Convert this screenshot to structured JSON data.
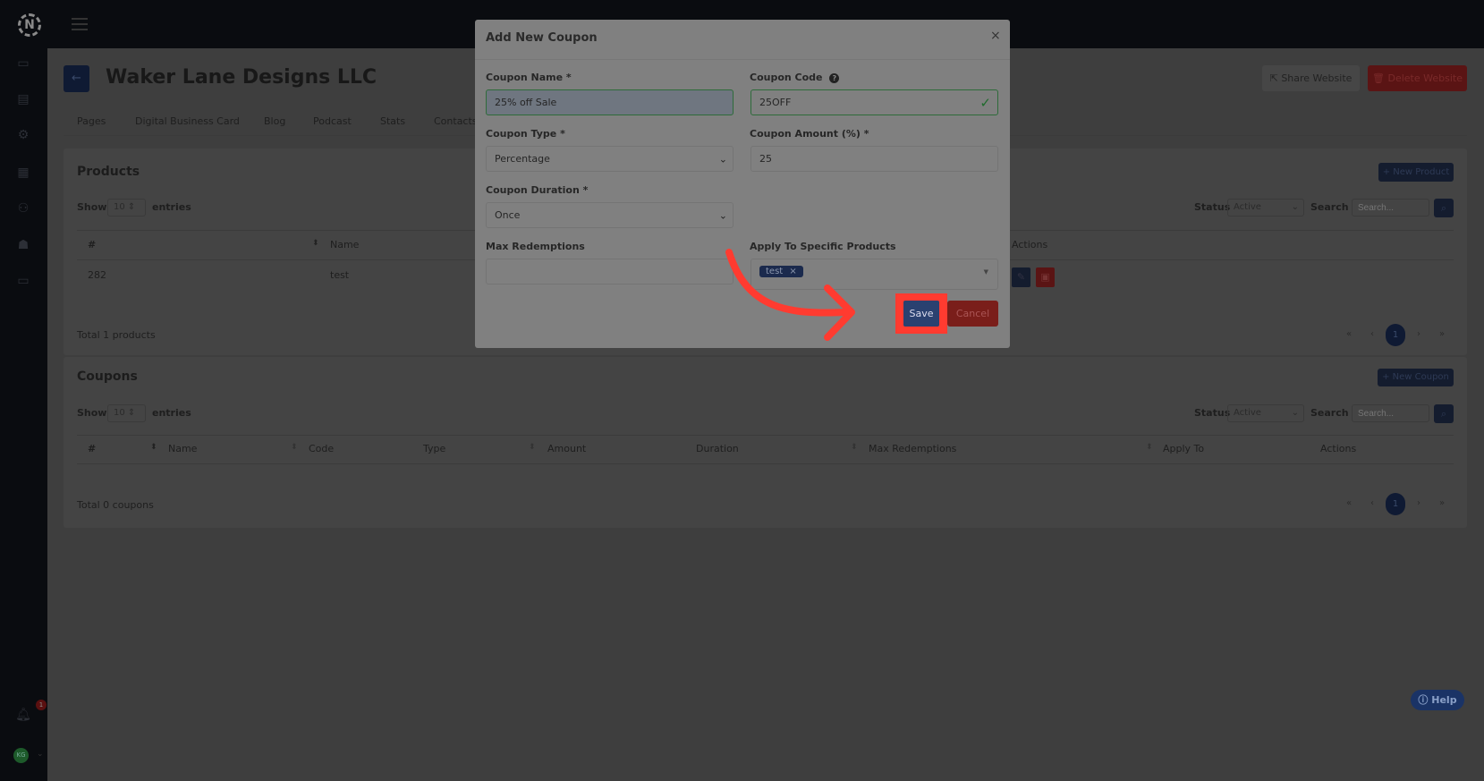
{
  "topbar": {
    "logo": "N",
    "menu_icon": "hamburger-icon"
  },
  "sidebar": {
    "icons": [
      "window-icon",
      "card-icon",
      "gear-icon",
      "widgets-icon",
      "add-user-icon",
      "team-icon",
      "video-icon"
    ],
    "notification_count": "1",
    "avatar_initials": "KG"
  },
  "header": {
    "title": "Waker Lane Designs LLC",
    "share_label": "Share Website",
    "delete_label": "Delete Website"
  },
  "tabs": [
    "Pages",
    "Digital Business Card",
    "Blog",
    "Podcast",
    "Stats",
    "Contacts"
  ],
  "products": {
    "title": "Products",
    "new_label": "New Product",
    "show": "Show",
    "entries_value": "10",
    "entries": "entries",
    "status_label": "Status",
    "status_value": "Active",
    "search_label": "Search",
    "search_placeholder": "Search...",
    "columns": [
      "#",
      "Name",
      "Actions"
    ],
    "rows": [
      {
        "id": "282",
        "name": "test"
      }
    ],
    "total": "Total 1 products",
    "page": "1"
  },
  "coupons": {
    "title": "Coupons",
    "new_label": "New Coupon",
    "show": "Show",
    "entries_value": "10",
    "entries": "entries",
    "status_label": "Status",
    "status_value": "Active",
    "search_label": "Search",
    "search_placeholder": "Search...",
    "columns": [
      "#",
      "Name",
      "Code",
      "Type",
      "Amount",
      "Duration",
      "Max Redemptions",
      "Apply To",
      "Actions"
    ],
    "total": "Total 0 coupons",
    "page": "1"
  },
  "modal": {
    "title": "Add New Coupon",
    "coupon_name_label": "Coupon Name *",
    "coupon_name_value": "25% off Sale",
    "coupon_code_label": "Coupon Code",
    "coupon_code_value": "25OFF",
    "coupon_type_label": "Coupon Type *",
    "coupon_type_value": "Percentage",
    "coupon_amount_label": "Coupon Amount (%) *",
    "coupon_amount_value": "25",
    "coupon_duration_label": "Coupon Duration *",
    "coupon_duration_value": "Once",
    "max_redemptions_label": "Max Redemptions",
    "max_redemptions_value": "",
    "apply_label": "Apply To Specific Products",
    "apply_tags": [
      "test"
    ],
    "save_label": "Save",
    "cancel_label": "Cancel"
  },
  "help_label": "Help",
  "colors": {
    "accent": "#2a4170",
    "danger": "#7a1e1a",
    "highlight": "#ff3b30",
    "valid": "#2e7d3a"
  }
}
